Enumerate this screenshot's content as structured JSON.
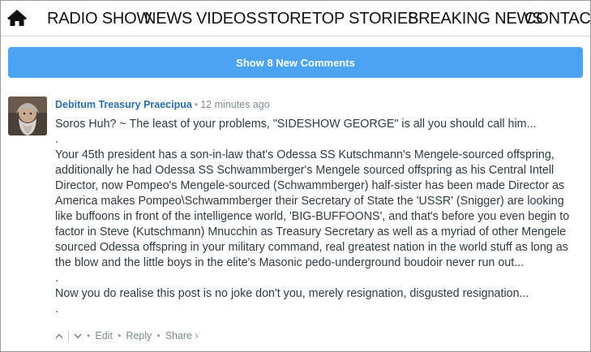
{
  "nav": {
    "home_icon": "home-icon",
    "items": [
      "RADIO SHOW",
      "NEWS",
      "VIDEOS",
      "STORE",
      "TOP STORIES",
      "BREAKING NEWS",
      "CONTACT"
    ]
  },
  "new_comments_button": "Show 8 New Comments",
  "comment": {
    "author": "Debitum Treasury Praecipua",
    "time": "12 minutes ago",
    "lines": [
      "Soros Huh? ~ The least of your problems, \"SIDESHOW GEORGE\" is all you should call him...",
      ".",
      "Your 45th president has a son-in-law that's Odessa SS Kutschmann's Mengele-sourced offspring,",
      "additionally he had Odessa SS Schwammberger's Mengele sourced offspring as his Central Intell",
      "Director, now Pompeo's Mengele-sourced (Schwammberger) half-sister has been made Director as",
      "America makes Pompeo\\Schwammberger their Secretary of State the 'USSR' (Snigger) are looking",
      "like buffoons in front of the intelligence world, 'BIG-BUFFOONS', and that's before you even begin to",
      "factor in Steve (Kutschmann) Mnucchin as Treasury Secretary as well as a myriad of other Mengele",
      "sourced Odessa offspring in your military command, real greatest nation in the world stuff as long as",
      "the blow and the little boys in the elite's Masonic pedo-underground boudoir never run out...",
      ".",
      "Now you do realise this post is no joke don't you, merely resignation, disgusted resignation...",
      "."
    ],
    "actions": {
      "upvote_icon": "upvote-icon",
      "downvote_icon": "downvote-icon",
      "edit": "Edit",
      "reply": "Reply",
      "share": "Share ›"
    }
  },
  "colors": {
    "accent_blue": "#4ba3f2",
    "author_link": "#2e6ea6",
    "body_text": "#2f3a45",
    "meta_text": "#7f8b96"
  }
}
